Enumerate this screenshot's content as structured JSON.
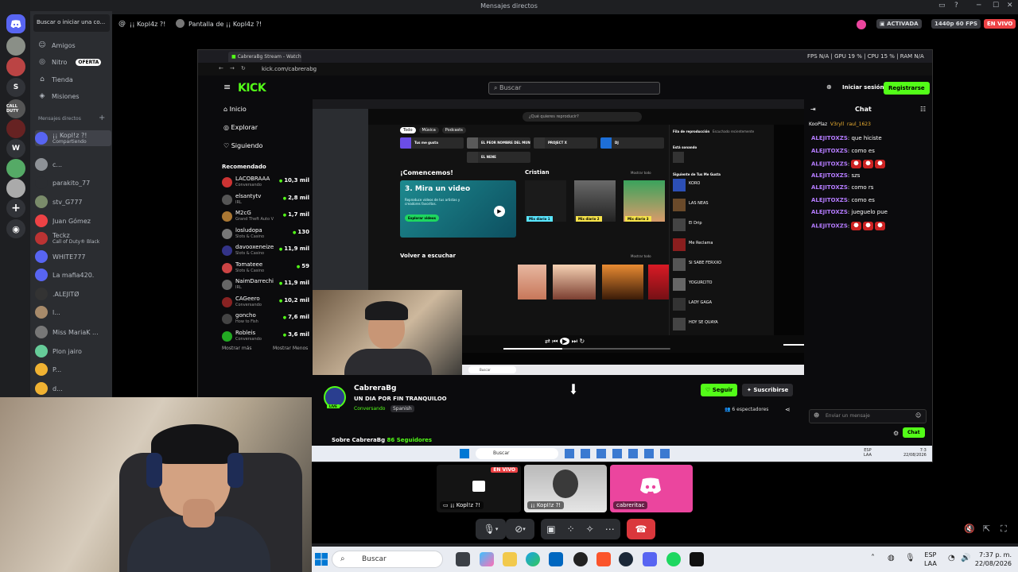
{
  "window": {
    "title": "Mensajes directos"
  },
  "sidebar": {
    "search_placeholder": "Buscar o iniciar una co...",
    "nav": [
      {
        "label": "Amigos",
        "icon": "friends-icon"
      },
      {
        "label": "Nitro",
        "icon": "nitro-icon",
        "badge": "OFERTA"
      },
      {
        "label": "Tienda",
        "icon": "shop-icon"
      },
      {
        "label": "Misiones",
        "icon": "quests-icon"
      }
    ],
    "dm_header": "Mensajes directos",
    "dms": [
      {
        "name": "¡¡ Kopl!z ?!",
        "sub": "Compartiendo",
        "color": "#5865f2"
      },
      {
        "name": "c...",
        "sub": "",
        "color": "#8e9297"
      },
      {
        "name": "parakito_77",
        "sub": "",
        "color": "#2b2d31"
      },
      {
        "name": "stv_G777",
        "sub": "",
        "color": "#7a8b6a"
      },
      {
        "name": "Juan Gómez",
        "sub": "",
        "color": "#ed4245"
      },
      {
        "name": "Teckz",
        "sub": "Call of Duty® Black",
        "color": "#b33"
      },
      {
        "name": "WHITE777",
        "sub": "",
        "color": "#5865f2"
      },
      {
        "name": "La mafia420.",
        "sub": "",
        "color": "#5865f2"
      },
      {
        "name": ".ALEJITØ",
        "sub": "",
        "color": "#333"
      },
      {
        "name": "l...",
        "sub": "",
        "color": "#a78a6a"
      },
      {
        "name": "Miss MariaK ...",
        "sub": "",
        "color": "#777"
      },
      {
        "name": "Plon jairo",
        "sub": "",
        "color": "#6c9"
      },
      {
        "name": "P...",
        "sub": "",
        "color": "#f0b232"
      },
      {
        "name": "d...",
        "sub": "",
        "color": "#f0b232"
      }
    ]
  },
  "header": {
    "user": "¡¡ Kopl4z ?!",
    "screen_title": "Pantalla de ¡¡ Kopl4z ?!",
    "activated": "ACTIVADA",
    "quality": "1440p 60 FPS",
    "live": "EN VIVO"
  },
  "browser": {
    "tab_title": "CabreraBg Stream - Watch",
    "url": "kick.com/cabrerabg",
    "perf": "FPS N/A | GPU 19 % | CPU 15 % | RAM N/A"
  },
  "kick": {
    "logo": "KICK",
    "search_placeholder": "Buscar",
    "login": "Iniciar sesión",
    "register": "Registrarse",
    "menu": [
      "Inicio",
      "Explorar",
      "Siguiendo"
    ],
    "recommended_title": "Recomendado",
    "recommended": [
      {
        "name": "LACOBRAAA",
        "sub": "Conversando",
        "viewers": "10,3 mil",
        "color": "#c33"
      },
      {
        "name": "elsantytv",
        "sub": "IRL",
        "viewers": "2,8 mil",
        "color": "#555"
      },
      {
        "name": "M2cG",
        "sub": "Grand Theft Auto V",
        "viewers": "1,7 mil",
        "color": "#a73"
      },
      {
        "name": "losludopa",
        "sub": "Slots & Casino",
        "viewers": "130",
        "color": "#777"
      },
      {
        "name": "davooxeneize",
        "sub": "Slots & Casino",
        "viewers": "11,9 mil",
        "color": "#338"
      },
      {
        "name": "Tomateee",
        "sub": "Slots & Casino",
        "viewers": "59",
        "color": "#c44"
      },
      {
        "name": "NaimDarrechi",
        "sub": "IRL",
        "viewers": "11,9 mil",
        "color": "#666"
      },
      {
        "name": "CAGeero",
        "sub": "Conversando",
        "viewers": "10,2 mil",
        "color": "#822"
      },
      {
        "name": "goncho",
        "sub": "How to Fish",
        "viewers": "7,6 mil",
        "color": "#444"
      },
      {
        "name": "Robleis",
        "sub": "Conversando",
        "viewers": "3,6 mil",
        "color": "#2a2"
      }
    ],
    "show_more": "Mostrar más",
    "show_less": "Mostrar Menos",
    "streamer": "CabreraBg",
    "stream_title": "UN DIA POR FIN TRANQUILOO",
    "category": "Conversando",
    "language": "Spanish",
    "follow": "Seguir",
    "subscribe": "Suscribirse",
    "viewers": "6 espectadores",
    "about": "Sobre CabreraBg",
    "followers": "86 Seguidores",
    "live_tag": "LIVE"
  },
  "spotify": {
    "welcome": "¡Comencemos!",
    "promo_title": "3. Mira un video",
    "promo_text": "Reproduce videos de tus artistas y creadores favoritos.",
    "promo_button": "Explorar videos",
    "section": "Cristian",
    "show_all": "Mostrar todo",
    "listen_again": "Volver a escuchar",
    "search_placeholder": "¿Qué quieres reproducir?",
    "chips": [
      "Todo",
      "Música",
      "Podcasts"
    ],
    "queue_title": "Fila de reproducción",
    "recent_title": "Escuchado recientemente",
    "now_playing": "Está sonando",
    "queue_next": "Siguiente de Tus Me Gusta",
    "queue": [
      "KORO",
      "LAS NEAS",
      "El Drip",
      "Me Reclama",
      "SI SABE FERXXO",
      "YOGURCITO",
      "LADY GAGA",
      "HOY SE QUAYA"
    ],
    "pills": [
      "Mix diario 1",
      "Mix diario 2",
      "Mix diario 3"
    ],
    "mixes": [
      "Tus me gusta",
      "EL PEOR NOMBRE DEL MUNDO",
      "PROJECT X",
      "DJ",
      "EL NENE"
    ]
  },
  "chat": {
    "title": "Chat",
    "top_users": [
      "KooPlaz",
      "V3ryll",
      "raul_1623"
    ],
    "messages": [
      {
        "user": "ALEJITOXZS",
        "text": "que hiciste",
        "emotes": false
      },
      {
        "user": "ALEJITOXZS",
        "text": "como es",
        "emotes": false
      },
      {
        "user": "ALEJITOXZS",
        "text": "",
        "emotes": true
      },
      {
        "user": "ALEJITOXZS",
        "text": "szs",
        "emotes": false
      },
      {
        "user": "ALEJITOXZS",
        "text": "como rs",
        "emotes": false
      },
      {
        "user": "ALEJITOXZS",
        "text": "como es",
        "emotes": false
      },
      {
        "user": "ALEJITOXZS",
        "text": "jueguelo pue",
        "emotes": false
      },
      {
        "user": "ALEJITOXZS",
        "text": "",
        "emotes": true
      }
    ],
    "input_placeholder": "Enviar un mensaje",
    "send": "Chat"
  },
  "shared_taskbar": {
    "search": "Buscar",
    "lang": "ESP\nLAA",
    "time": "7:3",
    "date": "22/08/2026"
  },
  "participants": [
    {
      "label": "¡¡ Kopl!z ?!",
      "live": "EN VIVO"
    },
    {
      "label": "¡¡ KopI!z ?!"
    },
    {
      "label": "cabreritac"
    }
  ],
  "taskbar": {
    "search": "Buscar",
    "lang_top": "ESP",
    "lang_bottom": "LAA",
    "time": "7:37 p. m.",
    "date": "22/08/2026"
  }
}
